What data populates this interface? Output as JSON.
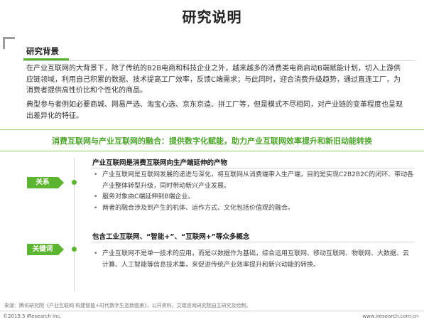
{
  "title": "研究说明",
  "background": {
    "heading": "研究背景",
    "paragraphs": [
      "在产业互联网的大背景下，除了传统的B2B电商和科技企业之外，越来越多的消费类电商启动B端赋能计划，切入上游供应链领域，利用自己积累的数据、技术提高工厂效率，反馈C端需求；与此同时，迎合消费升级趋势，通过直连工厂，为消费者提供高性价比和个性化的商品。",
      "典型参与者例如必要商城、网易严选、淘宝心选、京东京造、拼工厂等，但是模式不尽相同，对产业链的变革程度也呈现出差异化的特征。"
    ]
  },
  "headline": "消费互联网与产业互联网的融合：提供数字化赋能，助力产业互联网效率提升和新旧动能转换",
  "sections": [
    {
      "tag": "关系",
      "subheading": "产业互联网是消费互联网向生产端延伸的产物",
      "bullets": [
        "产业互联网是互联网发展的递进与深化，将互联网从消费端带入生产端，目的是实现C2B2B2C的闭环、带动各产业整体转型升级，同时带动新兴产业发展。",
        "服务对象由C端延伸到B端企业。",
        "两者的融合涉及到产生的机体、运作方式、文化包括价值观的融合。"
      ]
    },
    {
      "tag": "关键词",
      "subheading": "包含工业互联网、“智能+”、“互联网+”等众多概念",
      "bullets": [
        "产业互联网不是单一技术的应用，而是以数据作为基础，综合运用互联网、移动互联网、物联网、大数据、云计算、人工智能等信息技术集，来促进传统产业效率提升和新兴动能的转换。"
      ]
    }
  ],
  "footer": {
    "source": "来源：腾讯研究院《产业互联网 构建智能+时代数字生态新图景》，公开资料，艾瑞咨询研究院自主研究及绘制。",
    "copyright": "©2019.5 iResearch Inc.",
    "url": "www.iresearch.com.cn"
  }
}
